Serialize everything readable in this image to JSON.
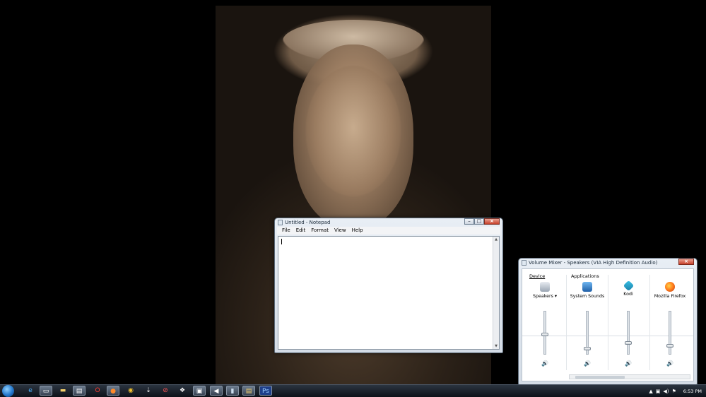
{
  "notepad": {
    "title": "Untitled - Notepad",
    "menu": [
      "File",
      "Edit",
      "Format",
      "View",
      "Help"
    ],
    "text": ""
  },
  "mixer": {
    "title": "Volume Mixer - Speakers (VIA High Definition Audio)",
    "device_label": "Device",
    "applications_label": "Applications",
    "channels": [
      {
        "name": "Speakers",
        "icon": "speaker-device-icon",
        "level": 0.45
      },
      {
        "name": "System Sounds",
        "icon": "system-sounds-icon",
        "level": 0.1
      },
      {
        "name": "Kodi",
        "icon": "kodi-icon",
        "level": 0.25
      },
      {
        "name": "Mozilla Firefox",
        "icon": "firefox-icon",
        "level": 0.18
      }
    ]
  },
  "taskbar": {
    "clock": "6:53 PM",
    "items": [
      "ie-icon",
      "media-player-icon",
      "explorer-icon",
      "notepad-task-icon",
      "opera-icon",
      "firefox-icon",
      "chrome-icon",
      "kodi-icon",
      "app-icon",
      "app-icon",
      "app-icon",
      "volume-icon",
      "folder-icon",
      "photoshop-icon"
    ]
  },
  "colors": {
    "accent": "#2a64b5",
    "close": "#c7402a"
  }
}
